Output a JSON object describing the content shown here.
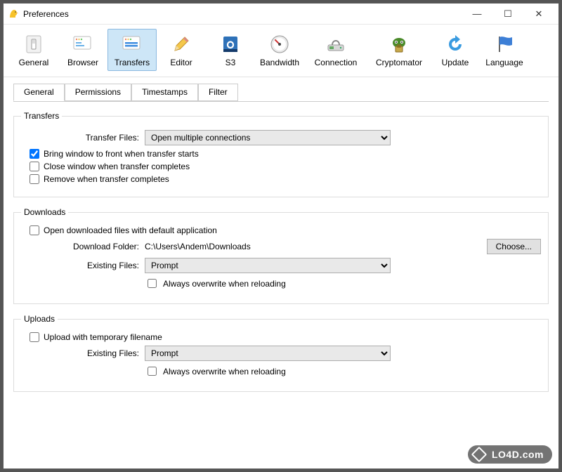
{
  "window": {
    "title": "Preferences"
  },
  "win_buttons": {
    "min": "—",
    "max": "☐",
    "close": "✕"
  },
  "toolbar": [
    {
      "id": "general",
      "label": "General"
    },
    {
      "id": "browser",
      "label": "Browser"
    },
    {
      "id": "transfers",
      "label": "Transfers",
      "active": true
    },
    {
      "id": "editor",
      "label": "Editor"
    },
    {
      "id": "s3",
      "label": "S3"
    },
    {
      "id": "bandwidth",
      "label": "Bandwidth"
    },
    {
      "id": "connection",
      "label": "Connection"
    },
    {
      "id": "cryptomator",
      "label": "Cryptomator"
    },
    {
      "id": "update",
      "label": "Update"
    },
    {
      "id": "language",
      "label": "Language"
    }
  ],
  "tabs": [
    {
      "label": "General",
      "active": true
    },
    {
      "label": "Permissions"
    },
    {
      "label": "Timestamps"
    },
    {
      "label": "Filter"
    }
  ],
  "transfers": {
    "legend": "Transfers",
    "transfer_files_label": "Transfer Files:",
    "transfer_files_value": "Open multiple connections",
    "chk_bring_front": {
      "label": "Bring window to front when transfer starts",
      "checked": true
    },
    "chk_close_complete": {
      "label": "Close window when transfer completes",
      "checked": false
    },
    "chk_remove_complete": {
      "label": "Remove when transfer completes",
      "checked": false
    }
  },
  "downloads": {
    "legend": "Downloads",
    "chk_open_default": {
      "label": "Open downloaded files with default application",
      "checked": false
    },
    "download_folder_label": "Download Folder:",
    "download_folder_value": "C:\\Users\\Andem\\Downloads",
    "choose_label": "Choose...",
    "existing_files_label": "Existing Files:",
    "existing_files_value": "Prompt",
    "always_overwrite": {
      "label": "Always overwrite when reloading",
      "checked": false
    }
  },
  "uploads": {
    "legend": "Uploads",
    "chk_temp_filename": {
      "label": "Upload with temporary filename",
      "checked": false
    },
    "existing_files_label": "Existing Files:",
    "existing_files_value": "Prompt",
    "always_overwrite": {
      "label": "Always overwrite when reloading",
      "checked": false
    }
  },
  "watermark": "LO4D.com"
}
